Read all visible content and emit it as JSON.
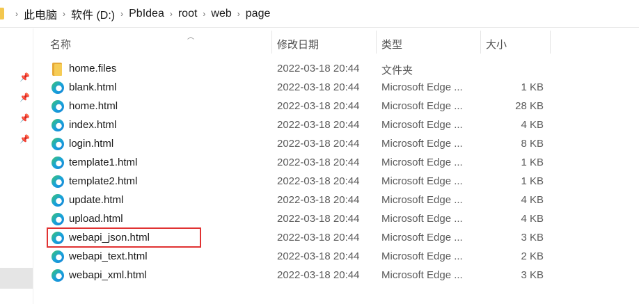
{
  "breadcrumb": {
    "items": [
      "此电脑",
      "软件 (D:)",
      "PbIdea",
      "root",
      "web",
      "page"
    ],
    "separator": "›"
  },
  "columns": {
    "name": "名称",
    "date": "修改日期",
    "type": "类型",
    "size": "大小"
  },
  "files": [
    {
      "name": "home.files",
      "date": "2022-03-18 20:44",
      "type": "文件夹",
      "size": "",
      "icon": "folder-icon"
    },
    {
      "name": "blank.html",
      "date": "2022-03-18 20:44",
      "type": "Microsoft Edge ...",
      "size": "1 KB",
      "icon": "edge-icon"
    },
    {
      "name": "home.html",
      "date": "2022-03-18 20:44",
      "type": "Microsoft Edge ...",
      "size": "28 KB",
      "icon": "edge-icon"
    },
    {
      "name": "index.html",
      "date": "2022-03-18 20:44",
      "type": "Microsoft Edge ...",
      "size": "4 KB",
      "icon": "edge-icon"
    },
    {
      "name": "login.html",
      "date": "2022-03-18 20:44",
      "type": "Microsoft Edge ...",
      "size": "8 KB",
      "icon": "edge-icon"
    },
    {
      "name": "template1.html",
      "date": "2022-03-18 20:44",
      "type": "Microsoft Edge ...",
      "size": "1 KB",
      "icon": "edge-icon"
    },
    {
      "name": "template2.html",
      "date": "2022-03-18 20:44",
      "type": "Microsoft Edge ...",
      "size": "1 KB",
      "icon": "edge-icon"
    },
    {
      "name": "update.html",
      "date": "2022-03-18 20:44",
      "type": "Microsoft Edge ...",
      "size": "4 KB",
      "icon": "edge-icon"
    },
    {
      "name": "upload.html",
      "date": "2022-03-18 20:44",
      "type": "Microsoft Edge ...",
      "size": "4 KB",
      "icon": "edge-icon"
    },
    {
      "name": "webapi_json.html",
      "date": "2022-03-18 20:44",
      "type": "Microsoft Edge ...",
      "size": "3 KB",
      "icon": "edge-icon"
    },
    {
      "name": "webapi_text.html",
      "date": "2022-03-18 20:44",
      "type": "Microsoft Edge ...",
      "size": "2 KB",
      "icon": "edge-icon"
    },
    {
      "name": "webapi_xml.html",
      "date": "2022-03-18 20:44",
      "type": "Microsoft Edge ...",
      "size": "3 KB",
      "icon": "edge-icon"
    }
  ],
  "highlighted_file": "webapi_json.html",
  "colors": {
    "highlight_border": "#e03232",
    "folder": "#f6cc56",
    "edge_blue": "#1683d8",
    "edge_green": "#3fc56a"
  }
}
